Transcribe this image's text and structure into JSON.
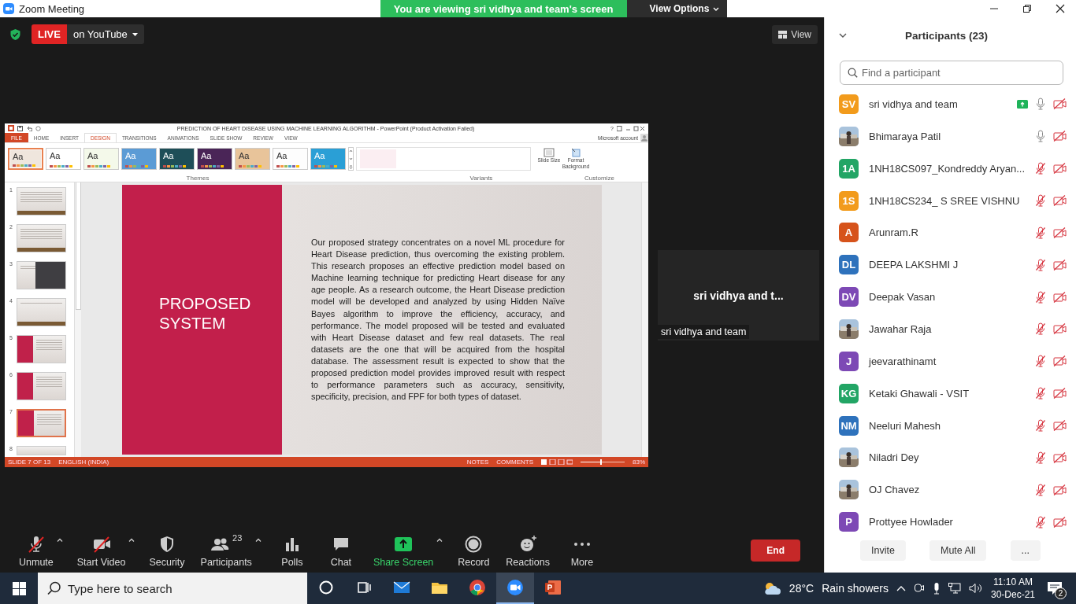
{
  "title_bar": {
    "title": "Zoom Meeting",
    "banner": "You are viewing sri vidhya and team's screen",
    "view_options": "View Options"
  },
  "meeting_bar": {
    "live": "LIVE",
    "stream": "on YouTube",
    "view": "View"
  },
  "shared_screen": {
    "title": "PREDICTION OF HEART DISEASE USING MACHINE LEARNING ALGORITHM - PowerPoint (Product Activation Failed)",
    "help": "?",
    "tabs": [
      {
        "label": "FILE",
        "kind": "file",
        "selected": false
      },
      {
        "label": "HOME",
        "kind": "tab",
        "selected": false
      },
      {
        "label": "INSERT",
        "kind": "tab",
        "selected": false
      },
      {
        "label": "DESIGN",
        "kind": "tab",
        "selected": true
      },
      {
        "label": "TRANSITIONS",
        "kind": "tab",
        "selected": false
      },
      {
        "label": "ANIMATIONS",
        "kind": "tab",
        "selected": false
      },
      {
        "label": "SLIDE SHOW",
        "kind": "tab",
        "selected": false
      },
      {
        "label": "REVIEW",
        "kind": "tab",
        "selected": false
      },
      {
        "label": "VIEW",
        "kind": "tab",
        "selected": false
      }
    ],
    "account": "Microsoft account",
    "themes": [
      {
        "label": "Aa",
        "color": "#efe6dd",
        "selected": true
      },
      {
        "label": "Aa",
        "color": "#ffffff",
        "selected": false
      },
      {
        "label": "Aa",
        "color": "#f4f9ea",
        "selected": false
      },
      {
        "label": "Aa",
        "color": "#5b9bd5",
        "selected": false
      },
      {
        "label": "Aa",
        "color": "#1e4e58",
        "selected": false
      },
      {
        "label": "Aa",
        "color": "#4a2557",
        "selected": false
      },
      {
        "label": "Aa",
        "color": "#e8c49a",
        "selected": false
      },
      {
        "label": "Aa",
        "color": "#fdfdfd",
        "selected": false
      },
      {
        "label": "Aa",
        "color": "#2a9fd6",
        "selected": false
      }
    ],
    "themes_label": "Themes",
    "variants_label": "Variants",
    "customize_label": "Customize",
    "slide_size": "Slide Size",
    "format_background": "Format Background",
    "thumbnails": [
      {
        "number": "1",
        "kind": "title",
        "selected": false
      },
      {
        "number": "2",
        "kind": "text",
        "selected": false
      },
      {
        "number": "3",
        "kind": "dark",
        "selected": false
      },
      {
        "number": "4",
        "kind": "section",
        "selected": false
      },
      {
        "number": "5",
        "kind": "red",
        "selected": false
      },
      {
        "number": "6",
        "kind": "red",
        "selected": false
      },
      {
        "number": "7",
        "kind": "red",
        "selected": true
      },
      {
        "number": "8",
        "kind": "partial",
        "selected": false
      }
    ],
    "slide": {
      "title": "PROPOSED SYSTEM",
      "body": "Our proposed strategy concentrates on a novel ML procedure for Heart Disease prediction, thus overcoming the existing problem. This research proposes an effective prediction model based on Machine learning technique for predicting Heart disease for any age people. As a research outcome, the Heart Disease prediction model will be developed and analyzed by using Hidden Naïve Bayes algorithm to improve the efficiency, accuracy, and performance. The model proposed will be tested and evaluated with Heart Disease dataset and few real datasets. The real datasets are the one that will be acquired from the hospital database. The assessment result is expected to show that the proposed prediction model provides improved result with respect to performance parameters such as accuracy, sensitivity, specificity, precision, and FPF for both types of dataset."
    },
    "status": {
      "slide": "SLIDE 7 OF 13",
      "language": "ENGLISH (INDIA)",
      "notes": "NOTES",
      "comments": "COMMENTS",
      "zoom": "83%",
      "level": 0.45
    }
  },
  "video_tile": {
    "name": "sri vidhya and t...",
    "label": "sri vidhya and team"
  },
  "toolbar": [
    {
      "kind": "mic",
      "label": "Unmute",
      "off": true,
      "menu": true
    },
    {
      "kind": "video",
      "label": "Start Video",
      "off": true,
      "menu": true
    },
    {
      "kind": "security",
      "label": "Security",
      "menu": false
    },
    {
      "kind": "participants",
      "label": "Participants",
      "count": "23",
      "menu": true
    },
    {
      "kind": "polls",
      "label": "Polls",
      "menu": false
    },
    {
      "kind": "chat",
      "label": "Chat",
      "menu": false
    },
    {
      "kind": "share",
      "label": "Share Screen",
      "highlight": true,
      "menu": true
    },
    {
      "kind": "record",
      "label": "Record",
      "menu": false
    },
    {
      "kind": "reactions",
      "label": "Reactions",
      "menu": false
    },
    {
      "kind": "more",
      "label": "More",
      "menu": false
    }
  ],
  "end_button": "End",
  "participants": {
    "title": "Participants (23)",
    "search": {
      "placeholder": "Find a participant"
    },
    "list": [
      {
        "kind": "initials",
        "initials": "SV",
        "color": "#f29b1c",
        "name": "sri vidhya and team",
        "sharing": true,
        "muted": false,
        "video_off": true
      },
      {
        "kind": "picture",
        "name": "Bhimaraya Patil",
        "sharing": false,
        "muted": false,
        "video_off": true
      },
      {
        "kind": "initials",
        "initials": "1A",
        "color": "#22a565",
        "name": "1NH18CS097_Kondreddy Aryan...",
        "sharing": false,
        "muted": true,
        "video_off": true
      },
      {
        "kind": "initials",
        "initials": "1S",
        "color": "#f29b1c",
        "name": "1NH18CS234_ S SREE VISHNU",
        "sharing": false,
        "muted": true,
        "video_off": true
      },
      {
        "kind": "initials",
        "initials": "A",
        "color": "#d6531b",
        "name": "Arunram.R",
        "sharing": false,
        "muted": true,
        "video_off": true
      },
      {
        "kind": "initials",
        "initials": "DL",
        "color": "#2e72bc",
        "name": "DEEPA LAKSHMI J",
        "sharing": false,
        "muted": true,
        "video_off": true
      },
      {
        "kind": "initials",
        "initials": "DV",
        "color": "#7d49b5",
        "name": "Deepak Vasan",
        "sharing": false,
        "muted": true,
        "video_off": true
      },
      {
        "kind": "picture",
        "name": "Jawahar Raja",
        "sharing": false,
        "muted": true,
        "video_off": true
      },
      {
        "kind": "initials",
        "initials": "J",
        "color": "#7d49b5",
        "name": "jeevarathinamt",
        "sharing": false,
        "muted": true,
        "video_off": true
      },
      {
        "kind": "initials",
        "initials": "KG",
        "color": "#22a565",
        "name": "Ketaki Ghawali - VSIT",
        "sharing": false,
        "muted": true,
        "video_off": true
      },
      {
        "kind": "initials",
        "initials": "NM",
        "color": "#2e72bc",
        "name": "Neeluri Mahesh",
        "sharing": false,
        "muted": true,
        "video_off": true
      },
      {
        "kind": "picture",
        "name": "Niladri Dey",
        "sharing": false,
        "muted": true,
        "video_off": true
      },
      {
        "kind": "picture",
        "name": "OJ Chavez",
        "sharing": false,
        "muted": true,
        "video_off": true
      },
      {
        "kind": "initials",
        "initials": "P",
        "color": "#7d49b5",
        "name": "Prottyee Howlader",
        "sharing": false,
        "muted": true,
        "video_off": true
      }
    ],
    "buttons": [
      "Invite",
      "Mute All",
      "..."
    ]
  },
  "taskbar": {
    "search": {
      "placeholder": "Type here to search"
    },
    "apps": [
      {
        "kind": "cortana",
        "selected": false
      },
      {
        "kind": "taskview",
        "selected": false
      },
      {
        "kind": "mail",
        "selected": false
      },
      {
        "kind": "files",
        "selected": false
      },
      {
        "kind": "chrome",
        "selected": false
      },
      {
        "kind": "zoom",
        "selected": true
      },
      {
        "kind": "powerpoint",
        "selected": false
      }
    ],
    "temperature": "28°C",
    "weather": "Rain showers",
    "time": "11:10 AM",
    "date": "30-Dec-21",
    "notifications": "2"
  }
}
